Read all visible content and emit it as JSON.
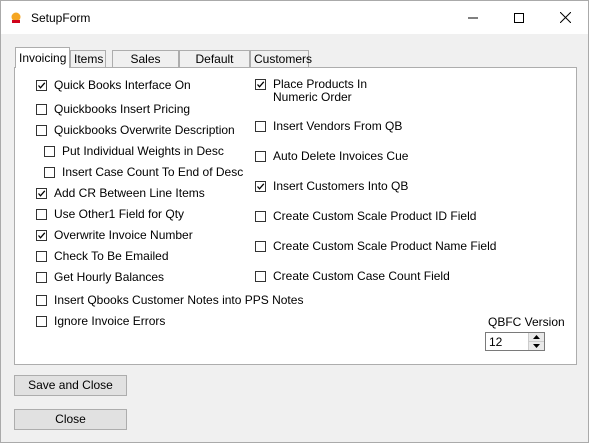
{
  "window": {
    "title": "SetupForm",
    "controls": [
      "minimize-icon",
      "maximize-icon",
      "close-icon"
    ]
  },
  "tabs": [
    {
      "label": "Invoicing",
      "active": true
    },
    {
      "label": "Items",
      "active": false
    },
    {
      "label": "Sales Order",
      "active": false
    },
    {
      "label": "Default Path",
      "active": false
    },
    {
      "label": "Customers",
      "active": false
    }
  ],
  "left_options": [
    {
      "label": "Quick Books Interface On",
      "checked": true
    },
    {
      "label": "Quickbooks Insert Pricing",
      "checked": false
    },
    {
      "label": "Quickbooks Overwrite Description",
      "checked": false
    },
    {
      "label": "Put Individual Weights in Desc",
      "checked": false
    },
    {
      "label": "Insert Case Count To End of Desc",
      "checked": false
    },
    {
      "label": "Add CR Between Line Items",
      "checked": true
    },
    {
      "label": "Use Other1 Field for Qty",
      "checked": false
    },
    {
      "label": "Overwrite Invoice Number",
      "checked": true
    },
    {
      "label": "Check To Be Emailed",
      "checked": false
    },
    {
      "label": "Get Hourly Balances",
      "checked": false
    },
    {
      "label": "Insert Qbooks Customer Notes into PPS Notes",
      "checked": false
    },
    {
      "label": "Ignore Invoice Errors",
      "checked": false
    }
  ],
  "right_options": [
    {
      "label": "Place Products In Numeric Order",
      "checked": true
    },
    {
      "label": "Insert Vendors From QB",
      "checked": false
    },
    {
      "label": "Auto Delete Invoices Cue",
      "checked": false
    },
    {
      "label": "Insert Customers Into QB",
      "checked": true
    },
    {
      "label": "Create Custom Scale Product ID Field",
      "checked": false
    },
    {
      "label": "Create Custom Scale Product Name Field",
      "checked": false
    },
    {
      "label": "Create Custom Case Count Field",
      "checked": false
    }
  ],
  "qbfc": {
    "label": "QBFC Version",
    "value": "12"
  },
  "buttons": {
    "save_close": "Save and Close",
    "close": "Close"
  }
}
